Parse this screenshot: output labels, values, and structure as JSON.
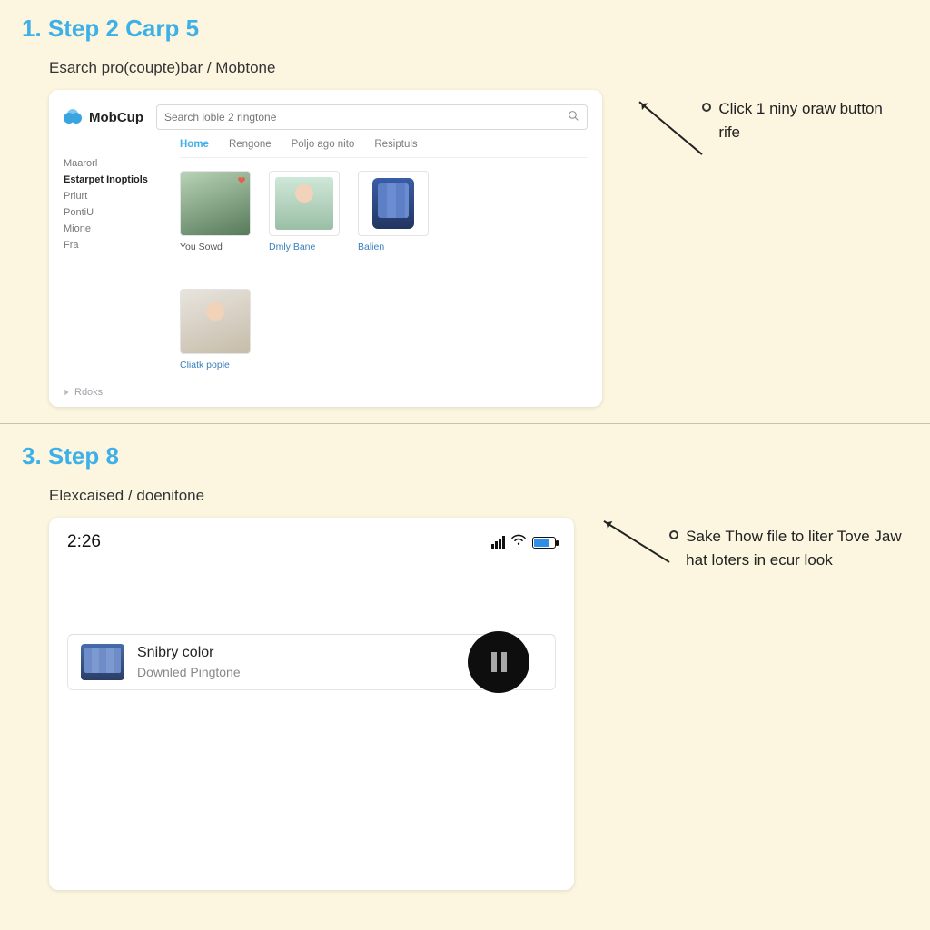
{
  "step1": {
    "heading": "1. Step 2 Carp 5",
    "subtitle": "Esarch pro(coupte)bar / Mobtone",
    "note": "Click 1 niny oraw button rife"
  },
  "mobcup": {
    "brand": "MobCup",
    "searchPlaceholder": "Search loble 2 ringtone",
    "sidebar": [
      "Maarorl",
      "Estarpet Inoptiols",
      "Priurt",
      "PontiU",
      "Mione",
      "Fra"
    ],
    "sidebarActiveIndex": 1,
    "tabs": [
      "Home",
      "Rengone",
      "Poljo ago nito",
      "Resiptuls"
    ],
    "tabsActiveIndex": 0,
    "tiles": [
      {
        "caption": "You Sowd",
        "captionClass": "dark",
        "kind": "photo",
        "heart": true
      },
      {
        "caption": "Dmly Bane",
        "captionClass": "",
        "kind": "person",
        "heart": false
      },
      {
        "caption": "Balien",
        "captionClass": "",
        "kind": "phone",
        "heart": false
      },
      {
        "caption": "Cliatk pople",
        "captionClass": "",
        "kind": "photo2",
        "heart": false
      }
    ],
    "footer": "Rdoks"
  },
  "step2": {
    "heading": "3. Step 8",
    "subtitle": "Elexcaised / doenitone",
    "note": "Sake Thow file to liter Tove Jaw hat loters in ecur look"
  },
  "phone": {
    "time": "2:26",
    "dlTitle": "Snibry color",
    "dlSub": "Downled Pingtone"
  }
}
